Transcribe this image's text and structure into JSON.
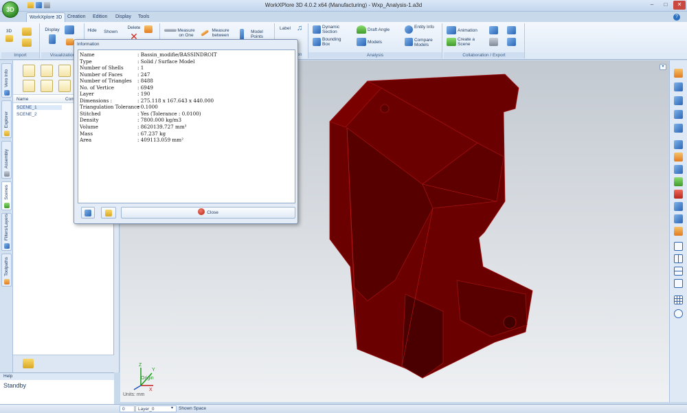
{
  "app": {
    "logo_text": "3D",
    "title": "WorkXPlore 3D 4.0.2 x64 (Manufacturing) - Wxp_Analysis-1.a3d"
  },
  "ribbon_tabs": [
    "WorkXplore 3D",
    "Creation",
    "Edition",
    "Display",
    "Tools"
  ],
  "ribbon": {
    "import": {
      "label": "Import",
      "btn_3d": "3D"
    },
    "visualization": {
      "label": "Visualization",
      "display": "Display",
      "hide": "Hide",
      "shown": "Shown"
    },
    "delete": "Delete",
    "measure_on_one": "Measure on One",
    "measure_between": "Measure between",
    "model_points": "Model Points",
    "label": "Label",
    "on_label": "on",
    "analysis": {
      "label": "Analysis",
      "dynamic_section": "Dynamic Section",
      "bounding_box": "Bounding Box",
      "draft_angle": "Draft Angle",
      "models": "Models",
      "entity_info": "Entity Info",
      "compare_models": "Compare Models"
    },
    "collab": {
      "label": "Collaboration / Export",
      "animation": "Animation",
      "create_scene": "Create a Scene"
    }
  },
  "side_tabs": [
    "Vero Info",
    "Explorer",
    "Assembly",
    "Scenes",
    "Filters/Layers",
    "Toolpaths"
  ],
  "left_panel": {
    "columns": [
      "Name",
      "Com"
    ],
    "rows": [
      "SCENE_1",
      "SCENE_2"
    ]
  },
  "help": {
    "title": "Help",
    "status": "Standby"
  },
  "viewport": {
    "units": "Units: mm",
    "axis": {
      "z": "Z",
      "y": "Y",
      "x": "X",
      "origin": "Origin"
    },
    "model_color": "#6b0000"
  },
  "statusbar": {
    "field1": "0",
    "layer": "Layer_0",
    "shown_space": "Shown Space"
  },
  "dialog": {
    "title": "Information",
    "rows": [
      {
        "k": "Name",
        "v": ": Bassin_modifie/BASSINDROIT"
      },
      {
        "k": "Type",
        "v": ": Solid / Surface Model"
      },
      {
        "k": "Number of Shells",
        "v": ": 1"
      },
      {
        "k": "Number of Faces",
        "v": ": 247"
      },
      {
        "k": "Number of Triangles",
        "v": ": 8488"
      },
      {
        "k": "No. of Vertice",
        "v": ": 6949"
      },
      {
        "k": "Layer",
        "v": ": 190"
      },
      {
        "k": "Dimensions :",
        "v": ": 275.118 x 167.643 x 440.000"
      },
      {
        "k": "Triangulation Tolerance",
        "v": ": 0.1000"
      },
      {
        "k": "Stitched",
        "v": ": Yes (Tolerance : 0.0100)"
      },
      {
        "k": "Density",
        "v": ": 7800.000 kg/m3"
      },
      {
        "k": "Volume",
        "v": ": 8620139.727 mm³"
      },
      {
        "k": "Mass",
        "v": ": 67.237 kg"
      },
      {
        "k": "Area",
        "v": ": 409113.059 mm²"
      }
    ],
    "close_label": "Close"
  }
}
